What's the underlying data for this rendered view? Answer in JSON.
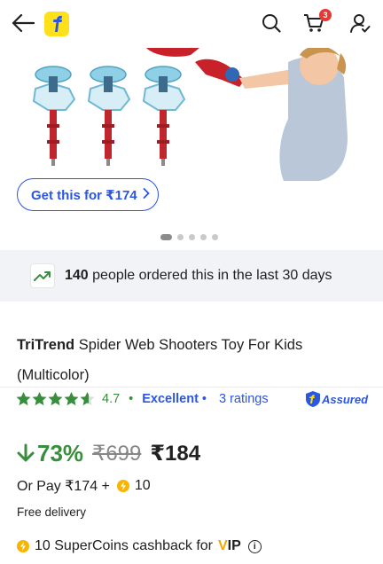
{
  "header": {
    "cart_count": "3",
    "icons": [
      "back-arrow-icon",
      "flipkart-logo",
      "search-icon",
      "cart-icon",
      "account-icon"
    ]
  },
  "hero": {
    "cta_label": "Get this for ₹174",
    "carousel_dots": 5,
    "active_dot": 1
  },
  "social_proof": {
    "count": "140",
    "text": " people ordered this in the last 30 days"
  },
  "product": {
    "brand": "TriTrend",
    "name": " Spider Web Shooters Toy For Kids (Multicolor)"
  },
  "rating": {
    "value": "4.7",
    "stars": 4.5,
    "label": "Excellent",
    "count_text": "3 ratings",
    "assured_label": "Assured"
  },
  "pricing": {
    "discount": "73%",
    "mrp": "₹699",
    "price": "₹184",
    "or_pay": "Or Pay ₹174 +",
    "supercoins": "10",
    "delivery": "Free delivery"
  },
  "cashback": {
    "text": "10 SuperCoins cashback for",
    "vip_v": "V",
    "vip_rest": "IP"
  },
  "colors": {
    "accent_blue": "#2A55E5",
    "green": "#388E3C",
    "badge_red": "#E53935",
    "strip_bg": "#F1F3F6"
  }
}
